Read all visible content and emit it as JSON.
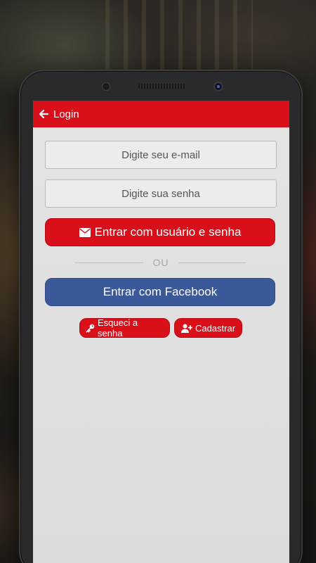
{
  "header": {
    "title": "Login",
    "back_icon": "arrow-left-icon"
  },
  "form": {
    "email_placeholder": "Digite seu e-mail",
    "password_placeholder": "Digite sua senha",
    "login_button_label": "Entrar com usuário e senha",
    "login_button_icon": "envelope-icon",
    "divider_text": "OU",
    "facebook_button_label": "Entrar com Facebook"
  },
  "links": {
    "forgot_password_label": "Esqueci a senha",
    "forgot_password_icon": "key-icon",
    "register_label": "Cadastrar",
    "register_icon": "user-plus-icon"
  },
  "colors": {
    "brand_red": "#d90f1a",
    "facebook_blue": "#3b5998",
    "screen_background": "#e0e0e0"
  }
}
